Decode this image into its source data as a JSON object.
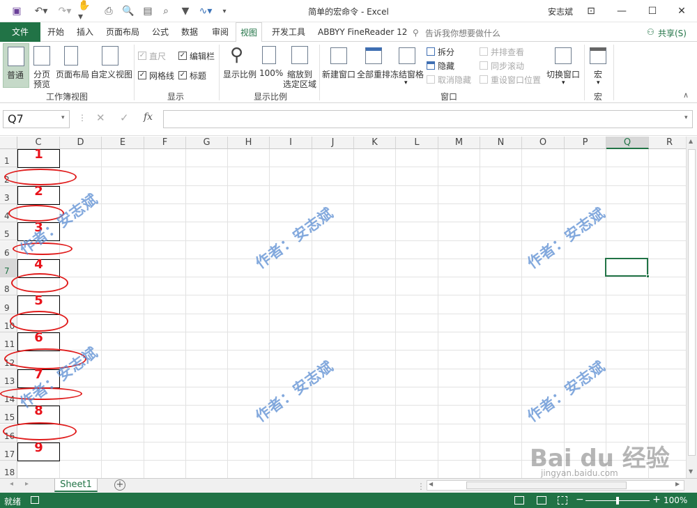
{
  "window": {
    "title": "简单的宏命令 - Excel",
    "user": "安志斌"
  },
  "tabs": [
    {
      "label": "文件"
    },
    {
      "label": "开始"
    },
    {
      "label": "插入"
    },
    {
      "label": "页面布局"
    },
    {
      "label": "公式"
    },
    {
      "label": "数据"
    },
    {
      "label": "审阅"
    },
    {
      "label": "视图"
    },
    {
      "label": "开发工具"
    },
    {
      "label": "ABBYY FineReader 12"
    }
  ],
  "tellme": "告诉我你想要做什么",
  "share": "共享(S)",
  "ribbon": {
    "views": {
      "normal": "普通",
      "pagebreak1": "分页",
      "pagebreak2": "预览",
      "pagelayout": "页面布局",
      "custom": "自定义视图",
      "group": "工作簿视图"
    },
    "show": {
      "ruler": "直尺",
      "formula_bar": "编辑栏",
      "gridlines": "网格线",
      "headings": "标题",
      "group": "显示"
    },
    "zoom": {
      "zoom": "显示比例",
      "z100": "100%",
      "zsel1": "缩放到",
      "zsel2": "选定区域",
      "group": "显示比例"
    },
    "window": {
      "new": "新建窗口",
      "arrange": "全部重排",
      "freeze": "冻结窗格",
      "split": "拆分",
      "hide": "隐藏",
      "unhide": "取消隐藏",
      "side": "并排查看",
      "sync": "同步滚动",
      "reset": "重设窗口位置",
      "switch": "切换窗口",
      "group": "窗口"
    },
    "macro": {
      "label": "宏",
      "group": "宏"
    }
  },
  "formula": {
    "name_box": "Q7",
    "fx": "fx"
  },
  "columns": [
    "C",
    "D",
    "E",
    "F",
    "G",
    "H",
    "I",
    "J",
    "K",
    "L",
    "M",
    "N",
    "O",
    "P",
    "Q",
    "R"
  ],
  "rows": [
    "1",
    "2",
    "3",
    "4",
    "5",
    "6",
    "7",
    "8",
    "9",
    "10",
    "11",
    "12",
    "13",
    "14",
    "15",
    "16",
    "17",
    "18"
  ],
  "cells_c": [
    "1",
    "2",
    "3",
    "4",
    "5",
    "6",
    "7",
    "8",
    "9"
  ],
  "watermark": "作者：安志斌",
  "sheet_tab": "Sheet1",
  "status": {
    "ready": "就绪",
    "zoom": "100%"
  },
  "baidu": {
    "logo": "Bai du 经验",
    "url": "jingyan.baidu.com"
  }
}
